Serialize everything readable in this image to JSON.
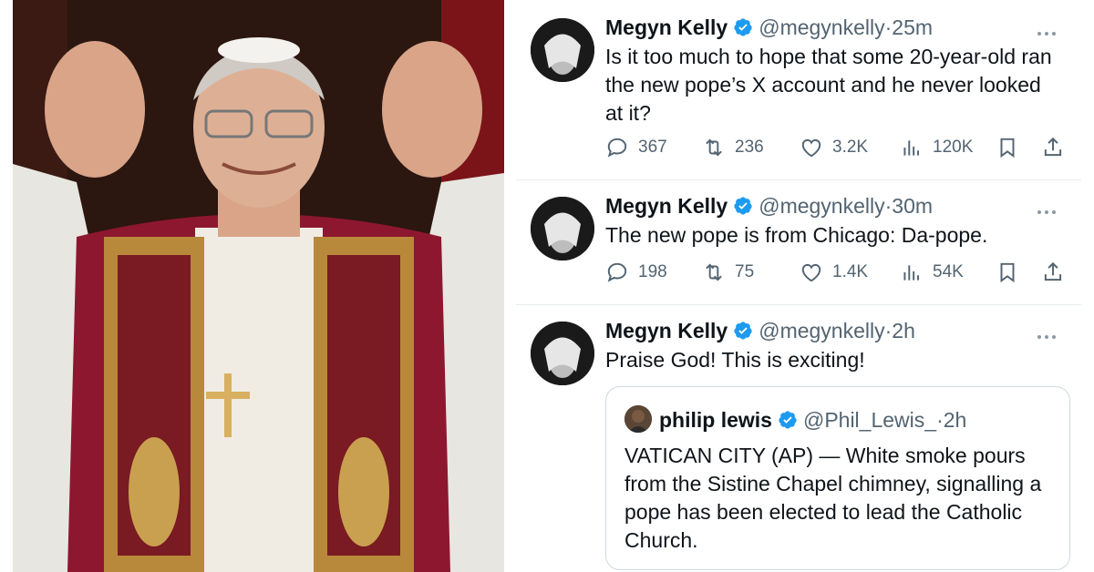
{
  "colors": {
    "verified": "#1d9bf0",
    "muted": "#536471",
    "border": "#cfd9de"
  },
  "tweets": [
    {
      "name": "Megyn Kelly",
      "handle": "@megynkelly",
      "sep": "·",
      "time": "25m",
      "text": "Is it too much to hope that some 20-year-old ran the new pope’s X account and he never looked at it?",
      "replies": "367",
      "reposts": "236",
      "likes": "3.2K",
      "views": "120K"
    },
    {
      "name": "Megyn Kelly",
      "handle": "@megynkelly",
      "sep": "·",
      "time": "30m",
      "text": "The new pope is from Chicago: Da-pope.",
      "replies": "198",
      "reposts": "75",
      "likes": "1.4K",
      "views": "54K"
    },
    {
      "name": "Megyn Kelly",
      "handle": "@megynkelly",
      "sep": "·",
      "time": "2h",
      "text": "Praise God! This is exciting!"
    }
  ],
  "quote": {
    "name": "philip lewis",
    "handle": "@Phil_Lewis_",
    "sep": "·",
    "time": "2h",
    "text": "VATICAN CITY (AP) — White smoke pours from the Sistine Chapel chimney, signalling a pope has been elected to lead the Catholic Church."
  },
  "icons": [
    "reply-icon",
    "repost-icon",
    "like-icon",
    "views-icon",
    "bookmark-icon",
    "share-icon",
    "verified-icon",
    "more-icon"
  ]
}
